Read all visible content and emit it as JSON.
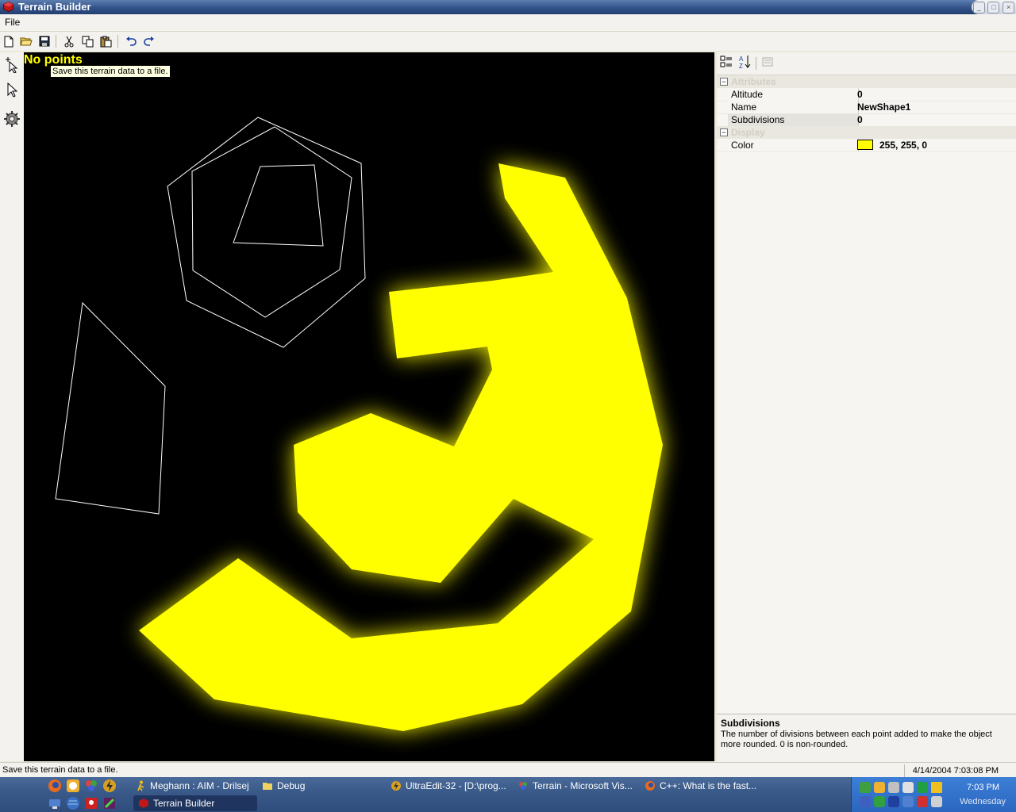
{
  "window": {
    "title": "Terrain Builder",
    "icon": "app-cube-icon"
  },
  "menu": {
    "items": [
      "File"
    ]
  },
  "toolbar": {
    "buttons": [
      "new-file-icon",
      "open-folder-icon",
      "save-icon",
      "cut-icon",
      "copy-icon",
      "paste-icon",
      "undo-icon",
      "redo-icon"
    ]
  },
  "left_tools": [
    "add-point-tool-icon",
    "select-arrow-icon",
    "settings-gear-icon"
  ],
  "canvas": {
    "status_label": "No points",
    "tooltip": "Save this terrain data to a file.",
    "fill_color": "#ffff00",
    "outline_color": "#ffffff",
    "background": "#000000"
  },
  "property_grid": {
    "categories": [
      {
        "name": "Attributes",
        "properties": [
          {
            "name": "Altitude",
            "value": "0"
          },
          {
            "name": "Name",
            "value": "NewShape1"
          },
          {
            "name": "Subdivisions",
            "value": "0",
            "selected": true
          }
        ]
      },
      {
        "name": "Display",
        "properties": [
          {
            "name": "Color",
            "value": "255, 255, 0",
            "swatch": "#ffff00"
          }
        ]
      }
    ],
    "description": {
      "title": "Subdivisions",
      "text": "The number of divisions between each point added to make the object more rounded.  0 is non-rounded."
    }
  },
  "statusbar": {
    "text": "Save this terrain data to a file.",
    "datetime": "4/14/2004 7:03:08 PM"
  },
  "taskbar": {
    "row1": [
      {
        "label": "Meghann : AIM - Drilsej"
      },
      {
        "label": "Debug"
      },
      {
        "label": "UltraEdit-32 - [D:\\prog..."
      },
      {
        "label": "Terrain - Microsoft Vis..."
      },
      {
        "label": "C++: What is the fast..."
      }
    ],
    "row2": [
      {
        "label": "Terrain Builder",
        "active": true
      }
    ],
    "tray": {
      "time": "7:03 PM",
      "day": "Wednesday"
    }
  }
}
